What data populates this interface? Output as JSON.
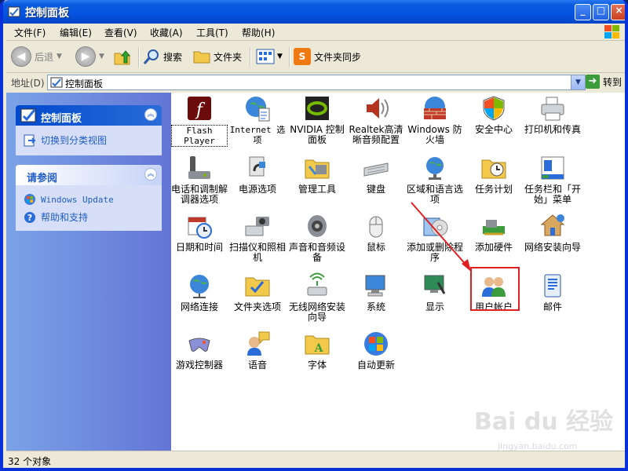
{
  "window": {
    "title": "控制面板"
  },
  "menu": [
    "文件(F)",
    "编辑(E)",
    "查看(V)",
    "收藏(A)",
    "工具(T)",
    "帮助(H)"
  ],
  "toolbar": {
    "back": "后退",
    "search": "搜索",
    "folders": "文件夹",
    "sync": "文件夹同步"
  },
  "address": {
    "label": "地址(D)",
    "value": "控制面板",
    "go": "转到"
  },
  "sidebar": {
    "panel_title": "控制面板",
    "switch_view": "切换到分类视图",
    "see_also_title": "请参阅",
    "see_also": [
      "Windows Update",
      "帮助和支持"
    ]
  },
  "items": [
    "Flash Player",
    "Internet 选项",
    "NVIDIA 控制面板",
    "Realtek高清晰音频配置",
    "Windows 防火墙",
    "安全中心",
    "打印机和传真",
    "电话和调制解调器选项",
    "电源选项",
    "管理工具",
    "键盘",
    "区域和语言选项",
    "任务计划",
    "任务栏和「开始」菜单",
    "日期和时间",
    "扫描仪和照相机",
    "声音和音频设备",
    "鼠标",
    "添加或删除程序",
    "添加硬件",
    "网络安装向导",
    "网络连接",
    "文件夹选项",
    "无线网络安装向导",
    "系统",
    "显示",
    "用户帐户",
    "邮件",
    "游戏控制器",
    "语音",
    "字体",
    "自动更新"
  ],
  "status": {
    "count": "32 个对象"
  },
  "watermark": {
    "brand": "Bai du 经验",
    "url": "jingyan.baidu.com"
  },
  "colors": {
    "titlebar": "#0553e0",
    "sidebar": "#6375d6",
    "highlight": "#e02020"
  }
}
